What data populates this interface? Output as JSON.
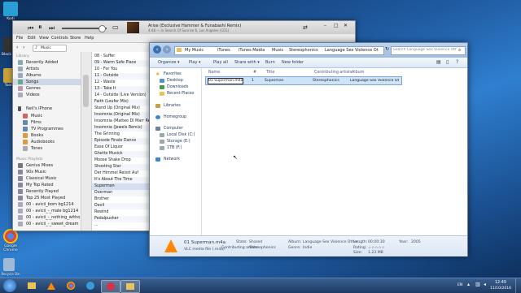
{
  "desktop": {
    "icons": [
      {
        "label": "Kodi"
      },
      {
        "label": "Black Ops"
      },
      {
        "label": "ToolKit"
      },
      {
        "label": "Google Chrome"
      },
      {
        "label": "Recycle Bin"
      }
    ]
  },
  "itunes": {
    "player": {
      "now_playing_title": "Arise (Exclusive Hammer & Funabashi Remix)",
      "now_playing_sub": "4:48  —  In Search Of Sunrise 6, Los Angeles (CD1)",
      "source": "Music",
      "search_placeholder": "Search Library"
    },
    "menu": [
      "File",
      "Edit",
      "View",
      "Controls",
      "Store",
      "Help"
    ],
    "sidebar": {
      "library_header": "Library",
      "library": [
        "Recently Added",
        "Artists",
        "Albums",
        "Songs",
        "Genres",
        "Videos"
      ],
      "device_header": "Neil's iPhone",
      "device_items": [
        "Music",
        "Films",
        "TV Programmes",
        "Books",
        "Audiobooks",
        "Tones"
      ],
      "playlists_header": "Music Playlists",
      "playlists": [
        "Genius Mixes",
        "90s Music",
        "Classical Music",
        "My Top Rated",
        "Recently Played",
        "Top 25 Most Played",
        "00 - avicii_bom bg1214",
        "00 - avicii_-_male bg1214",
        "00 - avicii_-_nothing_witho",
        "00 - avicii_-_sweet_dream"
      ]
    },
    "songs": [
      "08 - Suffer",
      "09 - Warm Safe Place",
      "10 - For You",
      "11 - Outside",
      "12 - Waste",
      "13 - Take It",
      "14 - Outside (Live Version)",
      "Faith (Loufer Mix)",
      "Stand Up (Original Mix)",
      "Insomnia (Original Mix)",
      "Insomnia (Matteo DI Marr Remix)",
      "Insomnia (Jewels Remix)",
      "The Grinning",
      "Episode Finale Dance",
      "Ease Of Liquor",
      "Ghetto Musick",
      "Moose Shake Drop",
      "Shooting Star",
      "Der Himmel Reisst Auf",
      "It's About The Time",
      "Superman",
      "Doorman",
      "Brother",
      "Devil",
      "Rewind",
      "Pedalpusher",
      "..."
    ]
  },
  "explorer": {
    "breadcrumb": [
      "My Music",
      "iTunes",
      "iTunes Media",
      "Music",
      "Stereophonics",
      "Language Sex Violence Other"
    ],
    "search_placeholder": "Search Language Sex Violence Other",
    "commands": [
      "Organize ▾",
      "Play ▾",
      "Play all",
      "Share with ▾",
      "Burn",
      "New folder"
    ],
    "nav": {
      "favorites": "Favorites",
      "fav_items": [
        "Desktop",
        "Downloads",
        "Recent Places"
      ],
      "libraries": "Libraries",
      "homegroup": "Homegroup",
      "computer": "Computer",
      "computer_items": [
        "Local Disk (C:)",
        "Storage (E:)",
        "1TB (F:)"
      ],
      "network": "Network"
    },
    "columns": [
      "Name",
      "#",
      "Title",
      "Contributing artists",
      "Album"
    ],
    "row": {
      "name_editing": "01 Superman.m4a",
      "number": "1",
      "title": "Superman",
      "artist": "Stereophonics",
      "album": "Language Sex Violence Other..."
    },
    "details": {
      "filename": "01 Superman.m4a",
      "filetype": "VLC media file (.m4a)",
      "state_label": "State:",
      "state_value": "Shared",
      "contrib_label": "Contributing artists:",
      "contrib_value": "Stereophonics",
      "album_label": "Album:",
      "album_value": "Language Sex Violence Other...",
      "genre_label": "Genre:",
      "genre_value": "Indie",
      "length_label": "Length:",
      "length_value": "00:00:30",
      "rating_label": "Rating:",
      "rating_value": "☆☆☆☆☆",
      "size_label": "Size:",
      "size_value": "1.23 MB",
      "year_label": "Year:",
      "year_value": "2005"
    }
  },
  "taskbar": {
    "lang": "EN",
    "time": "12:49",
    "date": "11/10/2016"
  }
}
